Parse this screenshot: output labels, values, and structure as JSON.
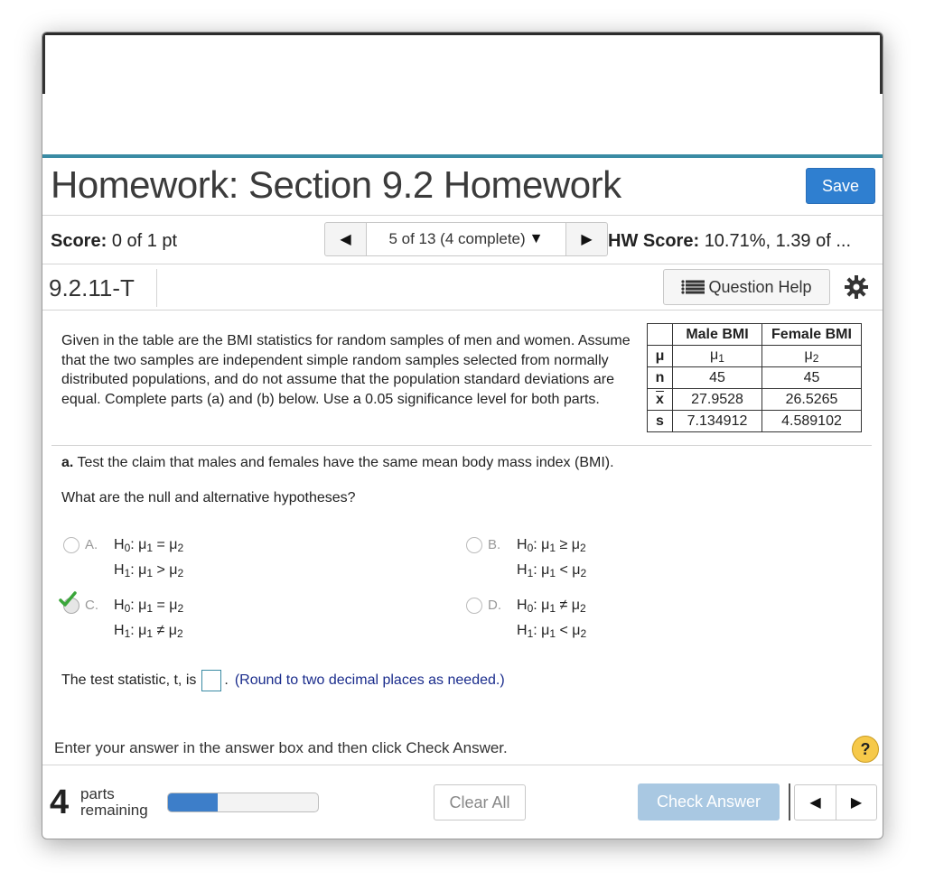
{
  "header": {
    "title": "Homework: Section 9.2 Homework",
    "save_label": "Save"
  },
  "status": {
    "score_label": "Score:",
    "score_value": "0 of 1 pt",
    "nav_position": "5 of 13 (4 complete)",
    "hw_score_label": "HW Score:",
    "hw_score_value": "10.71%, 1.39 of ..."
  },
  "question": {
    "id": "9.2.11-T",
    "help_label": "Question Help",
    "intro": "Given in the table are the BMI statistics for random samples of men and women. Assume that the two samples are independent simple random samples selected from normally distributed populations, and do not assume that the population standard deviations are equal. Complete parts (a) and (b) below. Use a 0.05 significance level for both parts.",
    "table": {
      "headers": [
        "",
        "Male BMI",
        "Female BMI"
      ],
      "rows": [
        {
          "label": "μ",
          "male": "μ1",
          "female": "μ2"
        },
        {
          "label": "n",
          "male": "45",
          "female": "45"
        },
        {
          "label": "x",
          "male": "27.9528",
          "female": "26.5265"
        },
        {
          "label": "s",
          "male": "7.134912",
          "female": "4.589102"
        }
      ]
    },
    "part_a_label": "a.",
    "part_a_text": "Test the claim that males and females have the same mean body mass index (BMI).",
    "hypothesis_question": "What are the null and alternative hypotheses?",
    "options": [
      {
        "letter": "A.",
        "h0": "H0: μ1 = μ2",
        "h1": "H1: μ1 > μ2",
        "selected": false
      },
      {
        "letter": "B.",
        "h0": "H0: μ1 ≥ μ2",
        "h1": "H1: μ1 < μ2",
        "selected": false
      },
      {
        "letter": "C.",
        "h0": "H0: μ1 = μ2",
        "h1": "H1: μ1 ≠ μ2",
        "selected": true
      },
      {
        "letter": "D.",
        "h0": "H0: μ1 ≠ μ2",
        "h1": "H1: μ1 < μ2",
        "selected": false
      }
    ],
    "test_stat_prefix": "The test statistic, t, is",
    "test_stat_value": "",
    "test_stat_suffix": ".",
    "round_note": "(Round to two decimal places as needed.)"
  },
  "footer": {
    "instruction": "Enter your answer in the answer box and then click Check Answer.",
    "help_symbol": "?",
    "parts_count": "4",
    "parts_word": "parts",
    "remaining_word": "remaining",
    "progress_fraction": 0.33,
    "clear_label": "Clear All",
    "check_label": "Check Answer"
  },
  "colors": {
    "accent": "#3a8ba4",
    "save": "#2f7fd0",
    "check_disabled": "#a9c8e2",
    "progress": "#3d7ec9",
    "check_mark": "#3aa63a",
    "help_badge": "#f6c94a"
  },
  "icons": {
    "prev": "triangle-left-icon",
    "next": "triangle-right-icon",
    "dropdown": "caret-down-icon",
    "help": "list-lines-icon",
    "settings": "gear-icon",
    "correct": "check-icon"
  }
}
